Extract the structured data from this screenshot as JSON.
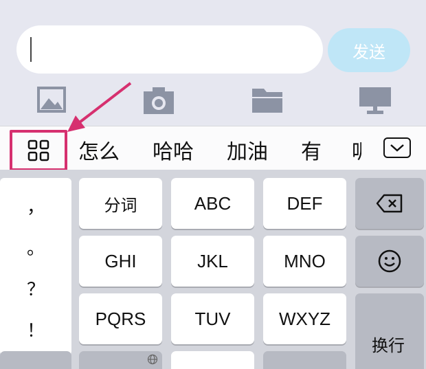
{
  "composer": {
    "send_label": "发送"
  },
  "toolbar": {
    "icons": [
      "image-icon",
      "camera-icon",
      "folder-icon",
      "desktop-icon"
    ]
  },
  "candidates": {
    "items": [
      "怎么",
      "哈哈",
      "加油",
      "有"
    ],
    "partial": "呢"
  },
  "keyboard": {
    "punctuation": [
      "，",
      "。",
      "？",
      "！"
    ],
    "row1": [
      "分词",
      "ABC",
      "DEF"
    ],
    "row2": [
      "GHI",
      "JKL",
      "MNO"
    ],
    "row3": [
      "PQRS",
      "TUV",
      "WXYZ"
    ],
    "return_label": "换行"
  },
  "colors": {
    "highlight": "#d6306f",
    "send_button": "#bfe6f7"
  }
}
